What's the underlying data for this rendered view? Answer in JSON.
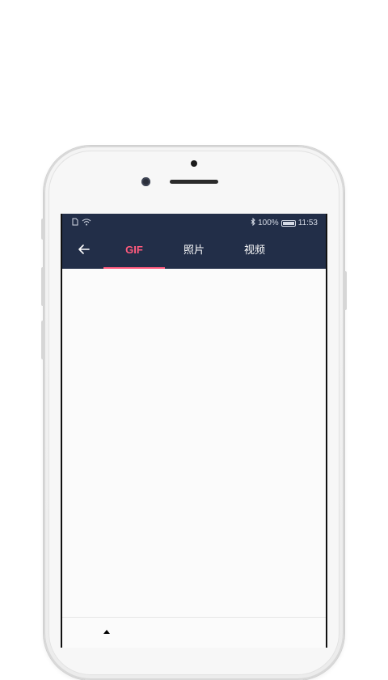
{
  "status_bar": {
    "battery": "100%",
    "time": "11:53",
    "icons": [
      "sim-icon",
      "wifi-icon",
      "bluetooth-icon",
      "battery-icon"
    ]
  },
  "toolbar": {
    "back_icon": "arrow-left-icon",
    "tabs": [
      {
        "label": "GIF",
        "active": true
      },
      {
        "label": "照片",
        "active": false
      },
      {
        "label": "视频",
        "active": false
      }
    ]
  },
  "colors": {
    "toolbar_bg": "#222e48",
    "accent": "#ff5a7d"
  }
}
